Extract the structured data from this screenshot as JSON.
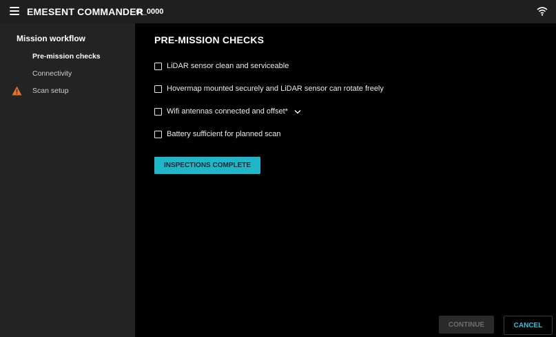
{
  "header": {
    "app_title": "EMESENT COMMANDER",
    "device_id": "st_0000",
    "icons": {
      "menu": "hamburger-menu-icon",
      "status": "wifi-icon"
    }
  },
  "sidebar": {
    "heading": "Mission workflow",
    "items": [
      {
        "label": "Pre-mission checks",
        "active": true
      },
      {
        "label": "Connectivity",
        "active": false
      },
      {
        "label": "Scan setup",
        "active": false,
        "warning": true
      }
    ],
    "warning_color": "#e8732a"
  },
  "main": {
    "title": "PRE-MISSION CHECKS",
    "checks": [
      {
        "label": "LiDAR sensor clean and serviceable",
        "checked": false
      },
      {
        "label": "Hovermap mounted securely and LiDAR sensor can rotate freely",
        "checked": false
      },
      {
        "label": "Wifi antennas connected and offset*",
        "checked": false,
        "expandable": true
      },
      {
        "label": "Battery sufficient for planned scan",
        "checked": false
      }
    ],
    "inspect_button": "INSPECTIONS COMPLETE",
    "accent_color": "#1fb6c9"
  },
  "footer": {
    "continue_label": "CONTINUE",
    "continue_disabled": true,
    "cancel_label": "CANCEL"
  }
}
